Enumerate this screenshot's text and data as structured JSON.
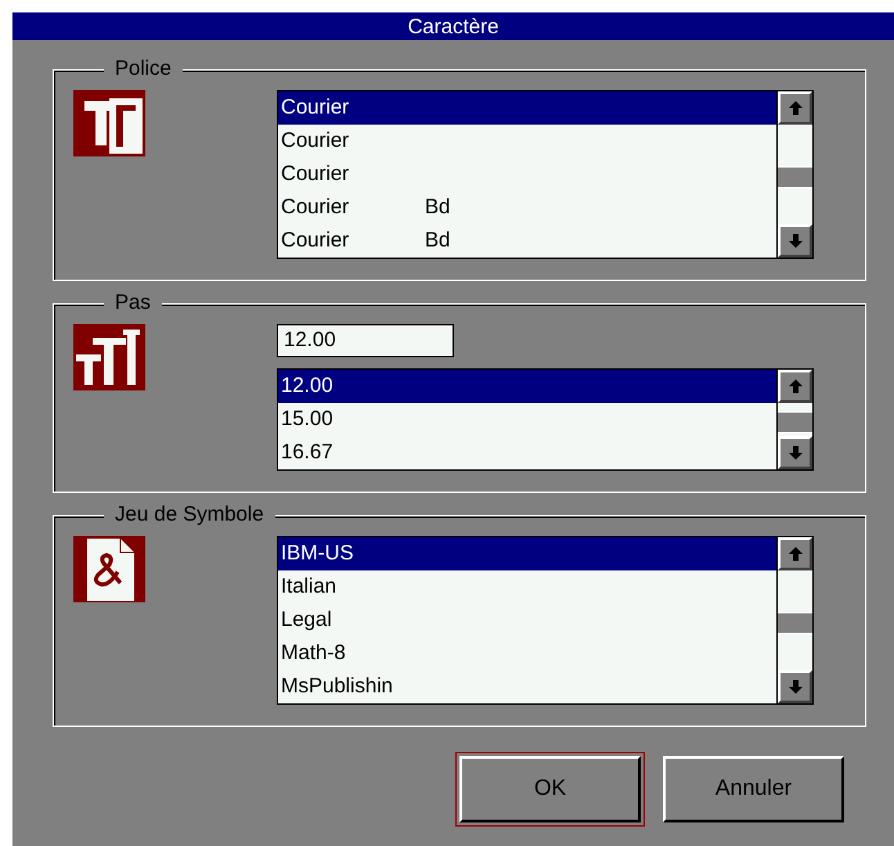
{
  "window": {
    "title": "Caractère"
  },
  "groups": [
    {
      "kind": "font",
      "label": "Police",
      "items": [
        {
          "name": "Courier",
          "selected": true
        },
        {
          "name": "Courier",
          "selected": false
        },
        {
          "name": "Courier",
          "selected": false
        },
        {
          "name": "Courier",
          "style": "Bd",
          "selected": false
        },
        {
          "name": "Courier",
          "style": "Bd",
          "selected": false
        }
      ]
    },
    {
      "kind": "pitch",
      "label": "Pas",
      "value": "12.00",
      "items": [
        {
          "name": "12.00",
          "selected": true
        },
        {
          "name": "15.00",
          "selected": false
        },
        {
          "name": "16.67",
          "selected": false
        }
      ]
    },
    {
      "kind": "symbols",
      "label": "Jeu de Symbole",
      "items": [
        {
          "name": "IBM-US",
          "selected": true
        },
        {
          "name": "Italian",
          "selected": false
        },
        {
          "name": "Legal",
          "selected": false
        },
        {
          "name": "Math-8",
          "selected": false
        },
        {
          "name": "MsPublishin",
          "selected": false
        }
      ]
    }
  ],
  "buttons": [
    {
      "label": "OK",
      "default": true
    },
    {
      "label": "Annuler",
      "default": false
    }
  ]
}
